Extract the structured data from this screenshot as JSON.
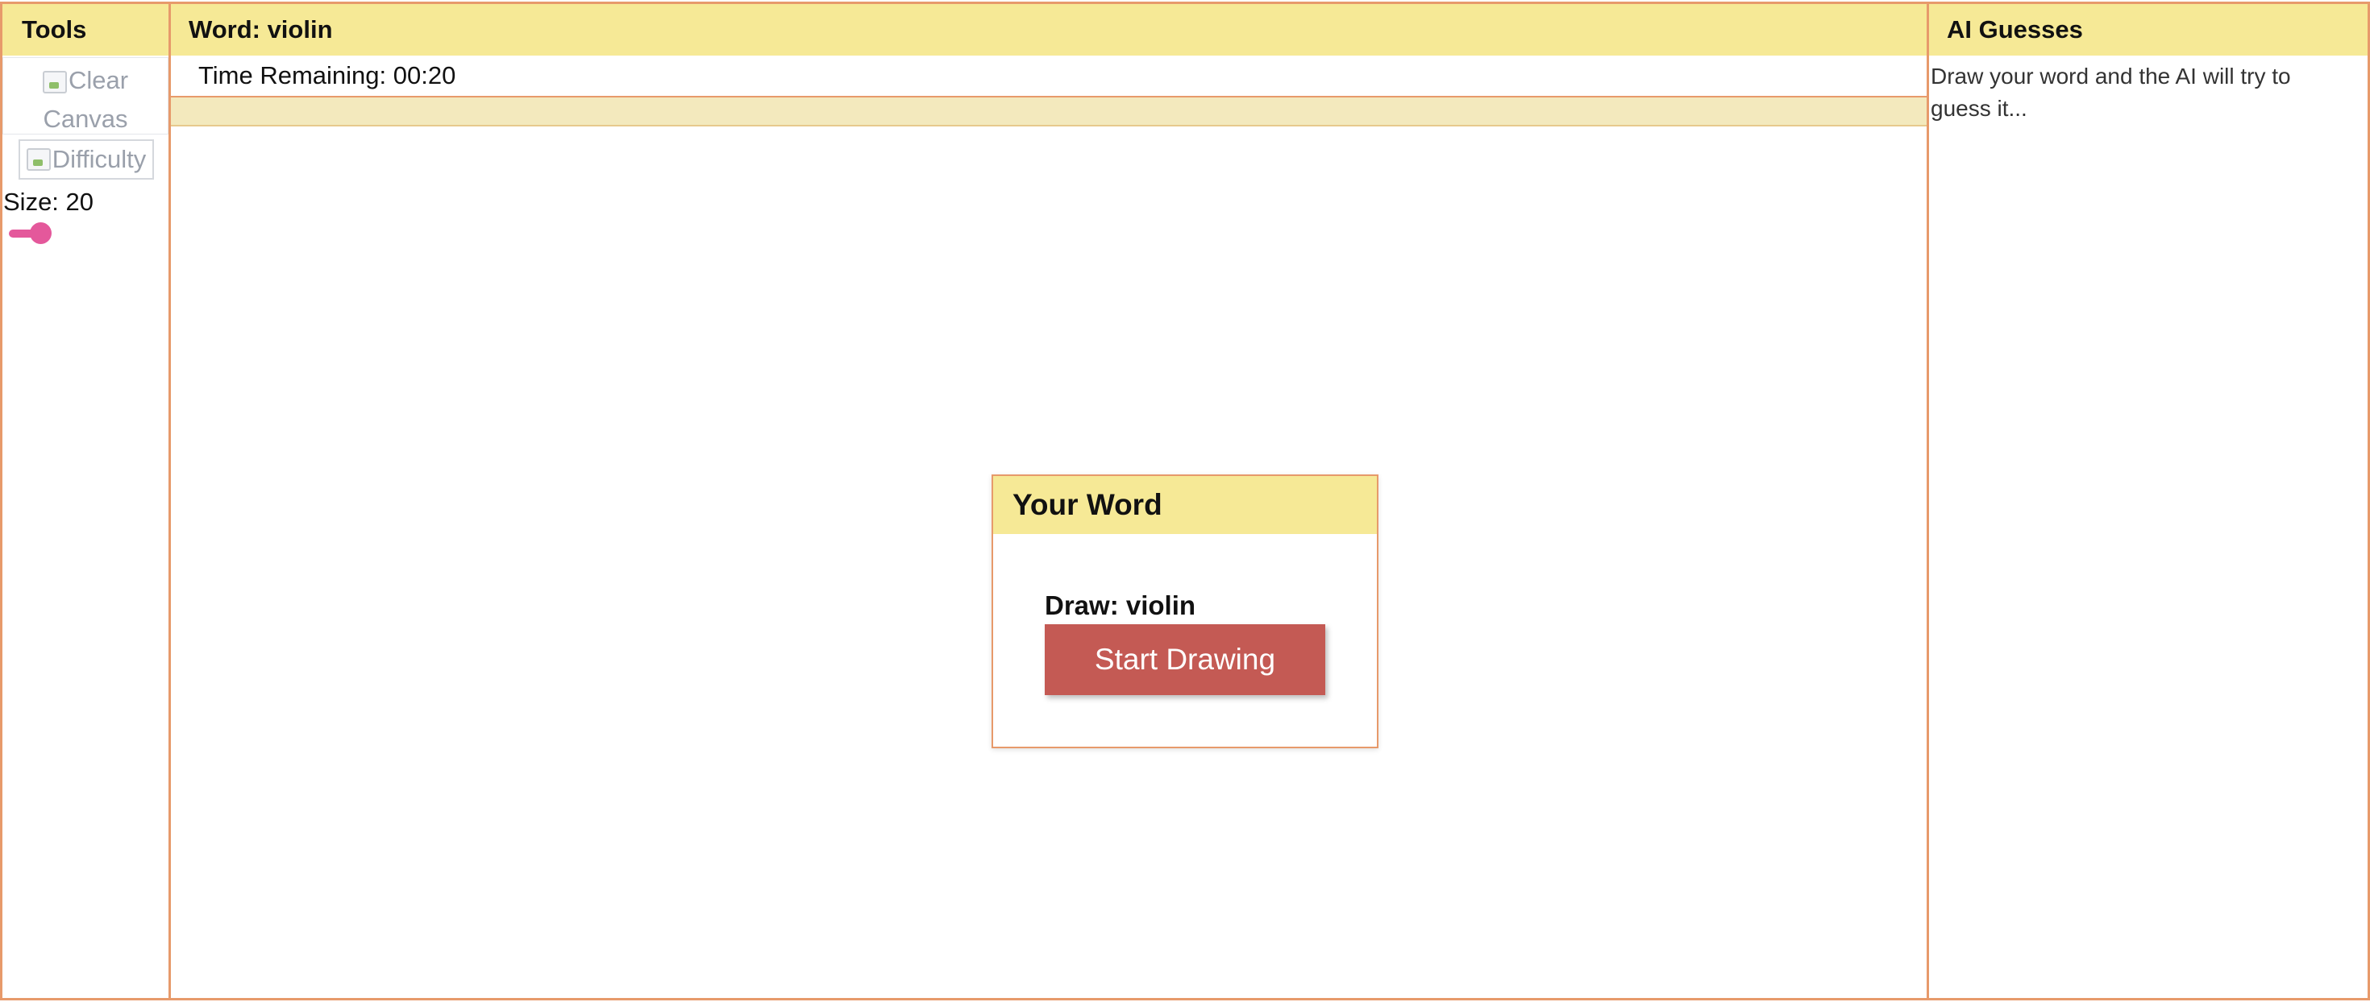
{
  "tools": {
    "title": "Tools",
    "clear_canvas_alt": "Clear Canvas",
    "difficulty_alt": "Difficulty",
    "size_label": "Size: 20",
    "size_value": 20,
    "slider_color": "#e4589b"
  },
  "game": {
    "word_title": "Word: violin",
    "time_remaining": "Time Remaining: 00:20",
    "time_progress_fraction": 0
  },
  "modal": {
    "title": "Your Word",
    "draw_text": "Draw: violin",
    "start_button": "Start Drawing"
  },
  "guesses": {
    "title": "AI Guesses",
    "placeholder": "Draw your word and the AI will try to guess it..."
  },
  "colors": {
    "header_bg": "#f6e996",
    "border": "#e79a6b",
    "button_bg": "#c45a54"
  }
}
